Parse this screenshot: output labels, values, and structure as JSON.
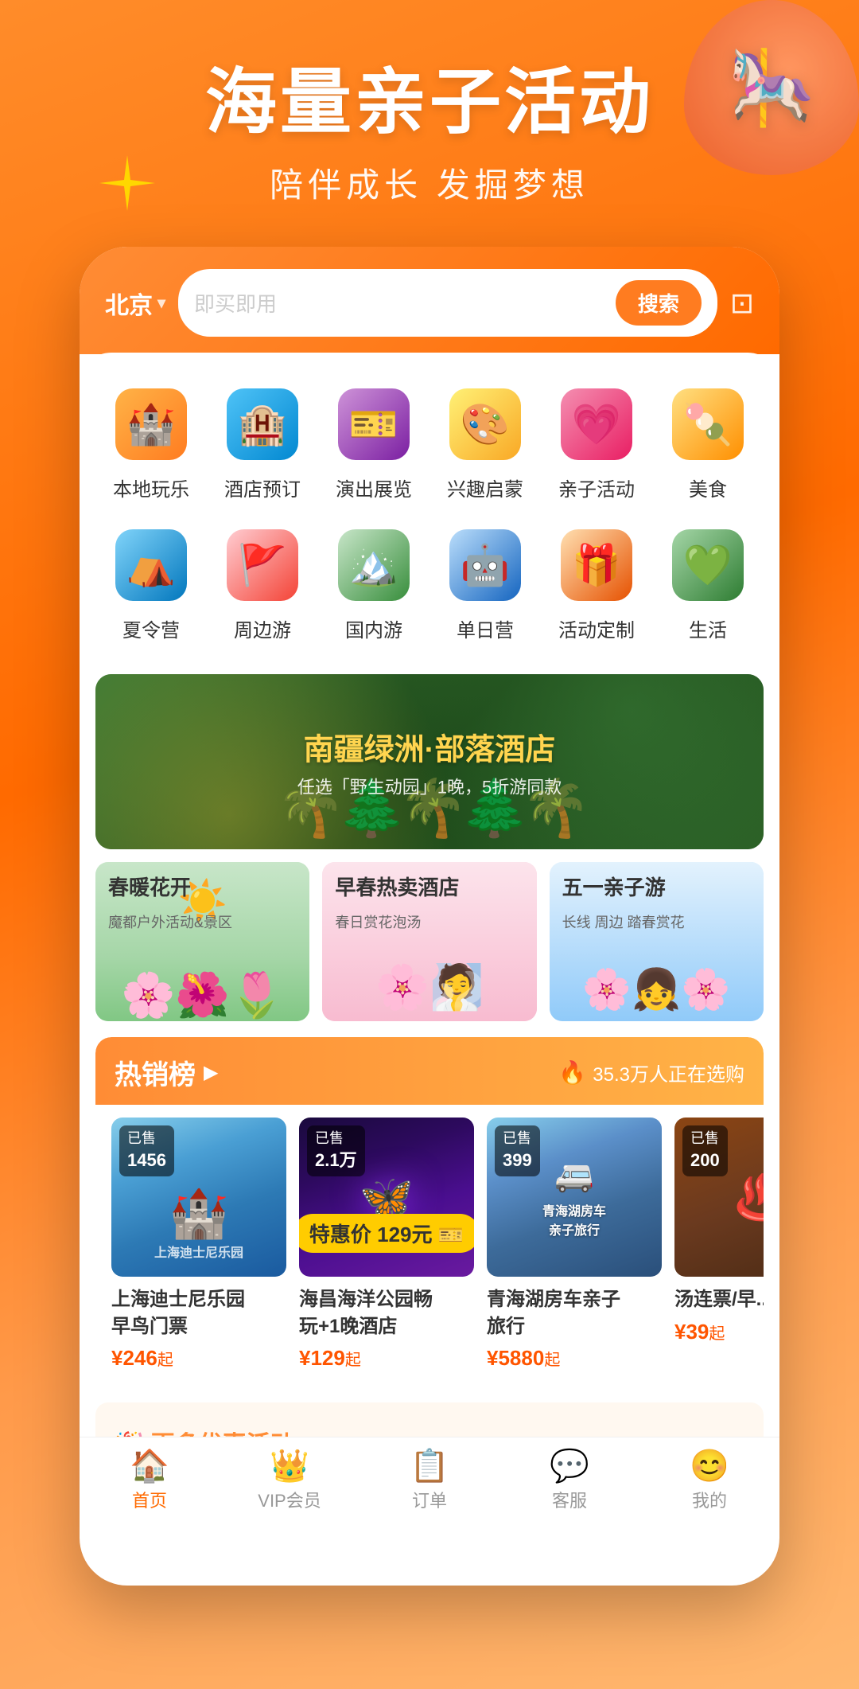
{
  "hero": {
    "title": "海量亲子活动",
    "subtitle": "陪伴成长 发掘梦想"
  },
  "search": {
    "location": "北京",
    "placeholder": "即买即用",
    "search_btn": "搜索"
  },
  "categories_row1": [
    {
      "id": "local-fun",
      "label": "本地玩乐",
      "icon": "🏰",
      "color_class": "icon-castle"
    },
    {
      "id": "hotel",
      "label": "酒店预订",
      "icon": "🏨",
      "color_class": "icon-hotel"
    },
    {
      "id": "show",
      "label": "演出展览",
      "icon": "🎫",
      "color_class": "icon-show"
    },
    {
      "id": "interest",
      "label": "兴趣启蒙",
      "icon": "🎨",
      "color_class": "icon-interest"
    },
    {
      "id": "family",
      "label": "亲子活动",
      "icon": "❤️",
      "color_class": "icon-family"
    },
    {
      "id": "food",
      "label": "美食",
      "icon": "🍭",
      "color_class": "icon-food"
    }
  ],
  "categories_row2": [
    {
      "id": "camp",
      "label": "夏令营",
      "icon": "⛺",
      "color_class": "icon-camp"
    },
    {
      "id": "nearby",
      "label": "周边游",
      "icon": "🚩",
      "color_class": "icon-nearby"
    },
    {
      "id": "domestic",
      "label": "国内游",
      "icon": "🏔️",
      "color_class": "icon-domestic"
    },
    {
      "id": "daycamp",
      "label": "单日营",
      "icon": "🤖",
      "color_class": "icon-daycamp"
    },
    {
      "id": "custom",
      "label": "活动定制",
      "icon": "🎁",
      "color_class": "icon-custom"
    },
    {
      "id": "life",
      "label": "生活",
      "icon": "💚",
      "color_class": "icon-life"
    }
  ],
  "main_banner": {
    "line1": "南疆绿洲",
    "line2": "部落酒店",
    "sub": "任选「野生动园」1晚，5折游同款"
  },
  "sub_banners": [
    {
      "id": "spring-flowers",
      "title": "春暖花开",
      "desc": "魔都户外活动&景区",
      "color": "1"
    },
    {
      "id": "hot-hotel",
      "title": "早春热卖酒店",
      "desc": "春日赏花泡汤",
      "color": "2"
    },
    {
      "id": "may-trip",
      "title": "五一亲子游",
      "desc": "长线 周边 踏春赏花",
      "color": "3"
    }
  ],
  "hot_section": {
    "title": "热销榜",
    "count_text": "35.3万人正在选购",
    "products": [
      {
        "id": "disney",
        "name": "上海迪士尼乐园早鸟门票",
        "sold_label": "已售",
        "sold_num": "1456",
        "price": "¥246",
        "price_suffix": "起",
        "img_class": "product-img-disney"
      },
      {
        "id": "ocean",
        "name": "海昌海洋公园畅玩+1晚酒店",
        "sold_label": "已售",
        "sold_num": "2.1万",
        "price": "¥129",
        "price_suffix": "起",
        "img_class": "product-img-ocean",
        "badge": "特惠价 129元"
      },
      {
        "id": "qinghai",
        "name": "青海湖房车亲子旅行",
        "sold_label": "已售",
        "sold_num": "399",
        "price": "¥5880",
        "price_suffix": "起",
        "img_class": "product-img-qinghai"
      },
      {
        "id": "hotspring",
        "name": "汤连票/早...",
        "sold_label": "已售",
        "sold_num": "200",
        "price": "¥39",
        "price_suffix": "起",
        "img_class": "product-img-hot"
      }
    ]
  },
  "bottom_nav": [
    {
      "id": "home",
      "label": "首页",
      "icon": "🏠",
      "active": true
    },
    {
      "id": "vip",
      "label": "VIP会员",
      "icon": "👑",
      "active": false
    },
    {
      "id": "orders",
      "label": "订单",
      "icon": "📋",
      "active": false
    },
    {
      "id": "service",
      "label": "客服",
      "icon": "💬",
      "active": false
    },
    {
      "id": "mine",
      "label": "我的",
      "icon": "😊",
      "active": false
    }
  ]
}
